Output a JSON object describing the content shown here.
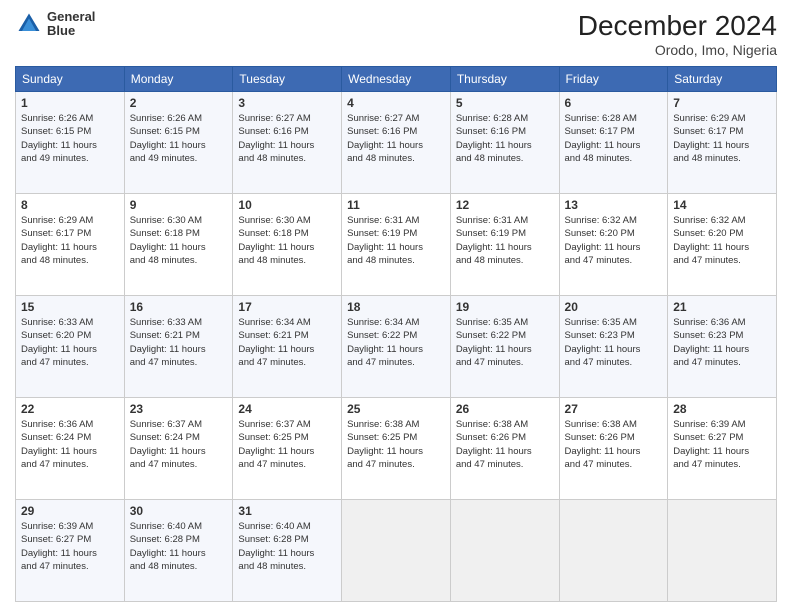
{
  "header": {
    "logo_line1": "General",
    "logo_line2": "Blue",
    "month_title": "December 2024",
    "location": "Orodo, Imo, Nigeria"
  },
  "days_of_week": [
    "Sunday",
    "Monday",
    "Tuesday",
    "Wednesday",
    "Thursday",
    "Friday",
    "Saturday"
  ],
  "weeks": [
    [
      {
        "day": "1",
        "info": "Sunrise: 6:26 AM\nSunset: 6:15 PM\nDaylight: 11 hours\nand 49 minutes."
      },
      {
        "day": "2",
        "info": "Sunrise: 6:26 AM\nSunset: 6:15 PM\nDaylight: 11 hours\nand 49 minutes."
      },
      {
        "day": "3",
        "info": "Sunrise: 6:27 AM\nSunset: 6:16 PM\nDaylight: 11 hours\nand 48 minutes."
      },
      {
        "day": "4",
        "info": "Sunrise: 6:27 AM\nSunset: 6:16 PM\nDaylight: 11 hours\nand 48 minutes."
      },
      {
        "day": "5",
        "info": "Sunrise: 6:28 AM\nSunset: 6:16 PM\nDaylight: 11 hours\nand 48 minutes."
      },
      {
        "day": "6",
        "info": "Sunrise: 6:28 AM\nSunset: 6:17 PM\nDaylight: 11 hours\nand 48 minutes."
      },
      {
        "day": "7",
        "info": "Sunrise: 6:29 AM\nSunset: 6:17 PM\nDaylight: 11 hours\nand 48 minutes."
      }
    ],
    [
      {
        "day": "8",
        "info": "Sunrise: 6:29 AM\nSunset: 6:17 PM\nDaylight: 11 hours\nand 48 minutes."
      },
      {
        "day": "9",
        "info": "Sunrise: 6:30 AM\nSunset: 6:18 PM\nDaylight: 11 hours\nand 48 minutes."
      },
      {
        "day": "10",
        "info": "Sunrise: 6:30 AM\nSunset: 6:18 PM\nDaylight: 11 hours\nand 48 minutes."
      },
      {
        "day": "11",
        "info": "Sunrise: 6:31 AM\nSunset: 6:19 PM\nDaylight: 11 hours\nand 48 minutes."
      },
      {
        "day": "12",
        "info": "Sunrise: 6:31 AM\nSunset: 6:19 PM\nDaylight: 11 hours\nand 48 minutes."
      },
      {
        "day": "13",
        "info": "Sunrise: 6:32 AM\nSunset: 6:20 PM\nDaylight: 11 hours\nand 47 minutes."
      },
      {
        "day": "14",
        "info": "Sunrise: 6:32 AM\nSunset: 6:20 PM\nDaylight: 11 hours\nand 47 minutes."
      }
    ],
    [
      {
        "day": "15",
        "info": "Sunrise: 6:33 AM\nSunset: 6:20 PM\nDaylight: 11 hours\nand 47 minutes."
      },
      {
        "day": "16",
        "info": "Sunrise: 6:33 AM\nSunset: 6:21 PM\nDaylight: 11 hours\nand 47 minutes."
      },
      {
        "day": "17",
        "info": "Sunrise: 6:34 AM\nSunset: 6:21 PM\nDaylight: 11 hours\nand 47 minutes."
      },
      {
        "day": "18",
        "info": "Sunrise: 6:34 AM\nSunset: 6:22 PM\nDaylight: 11 hours\nand 47 minutes."
      },
      {
        "day": "19",
        "info": "Sunrise: 6:35 AM\nSunset: 6:22 PM\nDaylight: 11 hours\nand 47 minutes."
      },
      {
        "day": "20",
        "info": "Sunrise: 6:35 AM\nSunset: 6:23 PM\nDaylight: 11 hours\nand 47 minutes."
      },
      {
        "day": "21",
        "info": "Sunrise: 6:36 AM\nSunset: 6:23 PM\nDaylight: 11 hours\nand 47 minutes."
      }
    ],
    [
      {
        "day": "22",
        "info": "Sunrise: 6:36 AM\nSunset: 6:24 PM\nDaylight: 11 hours\nand 47 minutes."
      },
      {
        "day": "23",
        "info": "Sunrise: 6:37 AM\nSunset: 6:24 PM\nDaylight: 11 hours\nand 47 minutes."
      },
      {
        "day": "24",
        "info": "Sunrise: 6:37 AM\nSunset: 6:25 PM\nDaylight: 11 hours\nand 47 minutes."
      },
      {
        "day": "25",
        "info": "Sunrise: 6:38 AM\nSunset: 6:25 PM\nDaylight: 11 hours\nand 47 minutes."
      },
      {
        "day": "26",
        "info": "Sunrise: 6:38 AM\nSunset: 6:26 PM\nDaylight: 11 hours\nand 47 minutes."
      },
      {
        "day": "27",
        "info": "Sunrise: 6:38 AM\nSunset: 6:26 PM\nDaylight: 11 hours\nand 47 minutes."
      },
      {
        "day": "28",
        "info": "Sunrise: 6:39 AM\nSunset: 6:27 PM\nDaylight: 11 hours\nand 47 minutes."
      }
    ],
    [
      {
        "day": "29",
        "info": "Sunrise: 6:39 AM\nSunset: 6:27 PM\nDaylight: 11 hours\nand 47 minutes."
      },
      {
        "day": "30",
        "info": "Sunrise: 6:40 AM\nSunset: 6:28 PM\nDaylight: 11 hours\nand 48 minutes."
      },
      {
        "day": "31",
        "info": "Sunrise: 6:40 AM\nSunset: 6:28 PM\nDaylight: 11 hours\nand 48 minutes."
      },
      {
        "day": "",
        "info": ""
      },
      {
        "day": "",
        "info": ""
      },
      {
        "day": "",
        "info": ""
      },
      {
        "day": "",
        "info": ""
      }
    ]
  ]
}
